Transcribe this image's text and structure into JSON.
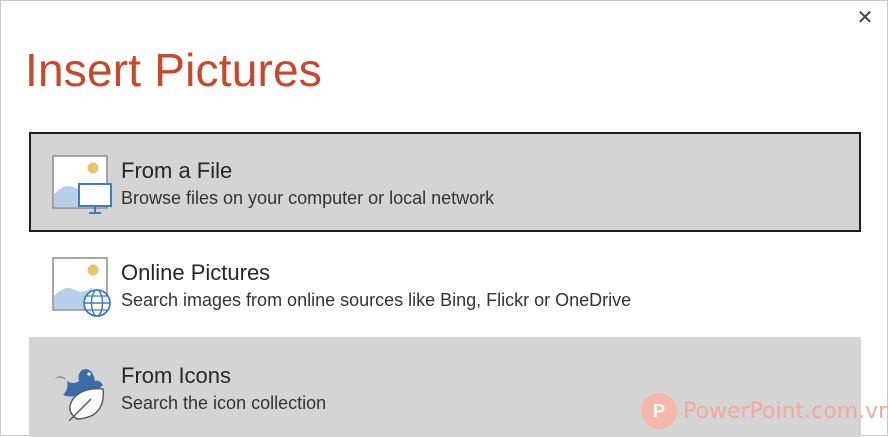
{
  "dialog": {
    "title": "Insert Pictures",
    "close_glyph": "✕"
  },
  "options": [
    {
      "title": "From a File",
      "description": "Browse files on your computer or local network",
      "icon": "picture-computer-icon",
      "state": "focused"
    },
    {
      "title": "Online Pictures",
      "description": "Search images from online sources like Bing, Flickr or OneDrive",
      "icon": "picture-globe-icon",
      "state": "normal"
    },
    {
      "title": "From Icons",
      "description": "Search the icon collection",
      "icon": "bird-leaf-icon",
      "state": "hover"
    }
  ],
  "watermark": {
    "logo_letter": "P",
    "text": "PowerPoint.com.vn"
  },
  "colors": {
    "title": "#c9472b",
    "selected_bg": "#d4d4d4",
    "icon_blue": "#3b7cc4",
    "sun": "#e8c46b",
    "mountain": "#b7cfe8"
  }
}
